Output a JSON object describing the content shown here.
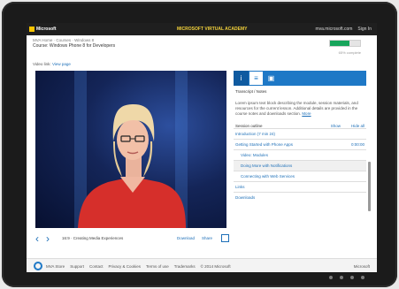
{
  "topbar": {
    "brand": "Microsoft",
    "center": "MICROSOFT VIRTUAL ACADEMY",
    "right_1": "mva.microsoft.com",
    "right_2": "Sign In"
  },
  "breadcrumb": "MVA Home · Courses · Windows 8",
  "page_title": "Course: Windows Phone 8 for Developers",
  "progress_percent": 65,
  "progress_caption": "65% complete",
  "subtitle_prefix": "Video link:",
  "subtitle_link": "View page",
  "player": {
    "caption_left": "16:9 · Creating Media Experiences",
    "caption_right_1": "Download",
    "caption_right_2": "Share"
  },
  "panel": {
    "tabs": [
      "i",
      "≡",
      "▣"
    ],
    "section_title": "Transcript / Notes",
    "description": "Lorem ipsum text block describing the module, session materials, and resources for the current lesson. Additional details are provided in the course notes and downloads section. ",
    "description_link": "More",
    "row_head": "Session outline",
    "row_links": [
      "Show",
      "Hide all"
    ],
    "items": [
      {
        "label": "Introduction (7 min 24)",
        "meta": ""
      },
      {
        "label": "Getting Started with Phone Apps",
        "meta": "0:00:00"
      },
      {
        "label": "Video: Modules",
        "meta": ""
      },
      {
        "label": "Doing More with Notifications",
        "meta": ""
      },
      {
        "label": "Connecting with Web Services",
        "meta": ""
      },
      {
        "label": "Links",
        "meta": ""
      },
      {
        "label": "Downloads",
        "meta": ""
      }
    ]
  },
  "footer": {
    "items": [
      "MVA Store",
      "Support",
      "Contact",
      "Privacy & Cookies",
      "Terms of use",
      "Trademarks",
      "© 2014 Microsoft"
    ],
    "right": "Microsoft"
  }
}
